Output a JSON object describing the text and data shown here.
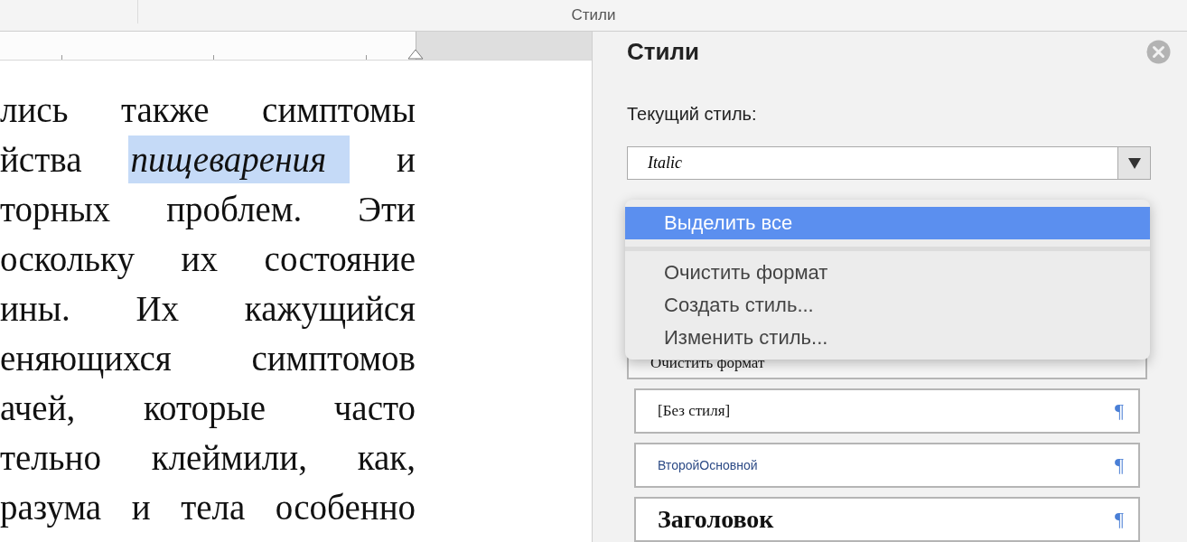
{
  "toolbar": {
    "title": "Стили"
  },
  "document": {
    "lines": [
      {
        "segments": [
          {
            "text": "лись также симптомы",
            "italic": false,
            "selected": false
          }
        ]
      },
      {
        "segments": [
          {
            "text": "йства",
            "italic": false,
            "selected": false
          },
          {
            "text": "пищеварения",
            "italic": true,
            "selected": true
          },
          {
            "text": "и",
            "italic": false,
            "selected": false
          }
        ]
      },
      {
        "segments": [
          {
            "text": "торных проблем. Эти",
            "italic": false,
            "selected": false
          }
        ]
      },
      {
        "segments": [
          {
            "text": "оскольку их состояние",
            "italic": false,
            "selected": false
          }
        ]
      },
      {
        "segments": [
          {
            "text": "ины. Их кажущийся",
            "italic": false,
            "selected": false
          }
        ]
      },
      {
        "segments": [
          {
            "text": "еняющихся симптомов",
            "italic": false,
            "selected": false
          }
        ]
      },
      {
        "segments": [
          {
            "text": "ачей, которые часто",
            "italic": false,
            "selected": false
          }
        ]
      },
      {
        "segments": [
          {
            "text": "тельно клеймили, как,",
            "italic": false,
            "selected": false
          }
        ]
      },
      {
        "segments": [
          {
            "text": "разума и тела особенно",
            "italic": false,
            "selected": false
          }
        ]
      }
    ]
  },
  "panel": {
    "title": "Стили",
    "current_label": "Текущий стиль:",
    "current_style": "Italic",
    "menu": [
      {
        "kind": "item",
        "label": "Выделить все",
        "selected": true
      },
      {
        "kind": "separator"
      },
      {
        "kind": "item",
        "label": "Очистить формат",
        "selected": false
      },
      {
        "kind": "item",
        "label": "Создать стиль...",
        "selected": false
      },
      {
        "kind": "item",
        "label": "Изменить стиль...",
        "selected": false
      }
    ],
    "styles": [
      {
        "kind": "clear",
        "name": "Очистить формат"
      },
      {
        "kind": "plain",
        "name": "[Без стиля]",
        "mark": "¶"
      },
      {
        "kind": "sans",
        "name": "ВторойОсновной",
        "mark": "¶"
      },
      {
        "kind": "heading",
        "name": "Заголовок",
        "mark": "¶"
      }
    ]
  }
}
